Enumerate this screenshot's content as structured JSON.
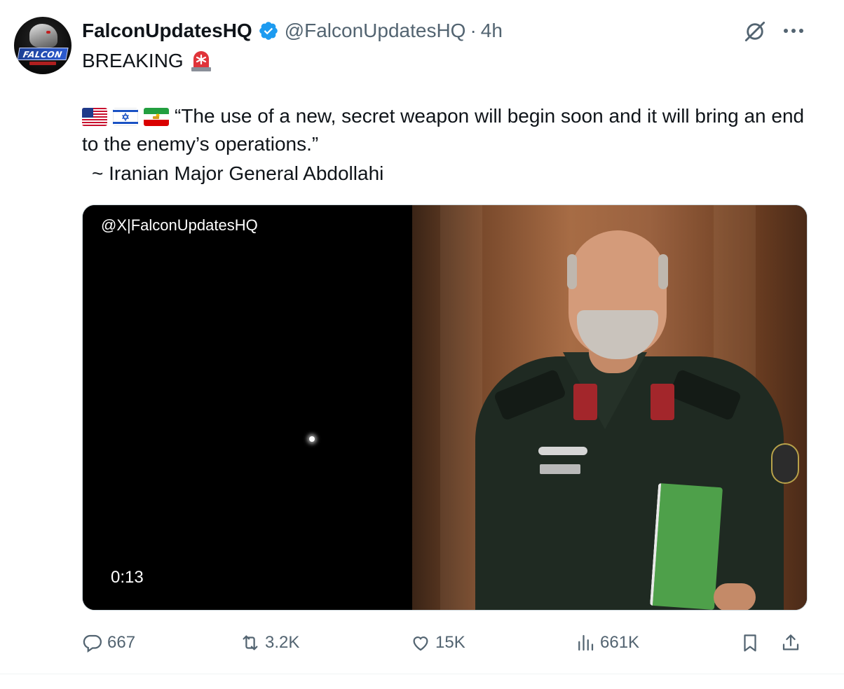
{
  "author": {
    "display_name": "FalconUpdatesHQ",
    "handle": "@FalconUpdatesHQ",
    "separator": "·",
    "time": "4h",
    "avatar_text": "FALCON"
  },
  "post": {
    "headline": "BREAKING",
    "quote": "“The use of a new, secret weapon will begin soon and it will bring an end to the enemy’s operations.”",
    "attribution": "~ Iranian Major General Abdollahi",
    "flags": [
      "us-flag-icon",
      "israel-flag-icon",
      "iran-lion-sun-flag-icon"
    ]
  },
  "media": {
    "watermark": "@X|FalconUpdatesHQ",
    "duration": "0:13"
  },
  "actions": {
    "replies": "667",
    "reposts": "3.2K",
    "likes": "15K",
    "views": "661K"
  },
  "colors": {
    "text_primary": "#0f1419",
    "text_secondary": "#536471",
    "verified_blue": "#1d9bf0",
    "border": "#cfd9de"
  },
  "icons": [
    "grok-icon",
    "more-icon",
    "verified-badge-icon",
    "siren-icon",
    "reply-icon",
    "repost-icon",
    "like-icon",
    "views-icon",
    "bookmark-icon",
    "share-icon"
  ]
}
